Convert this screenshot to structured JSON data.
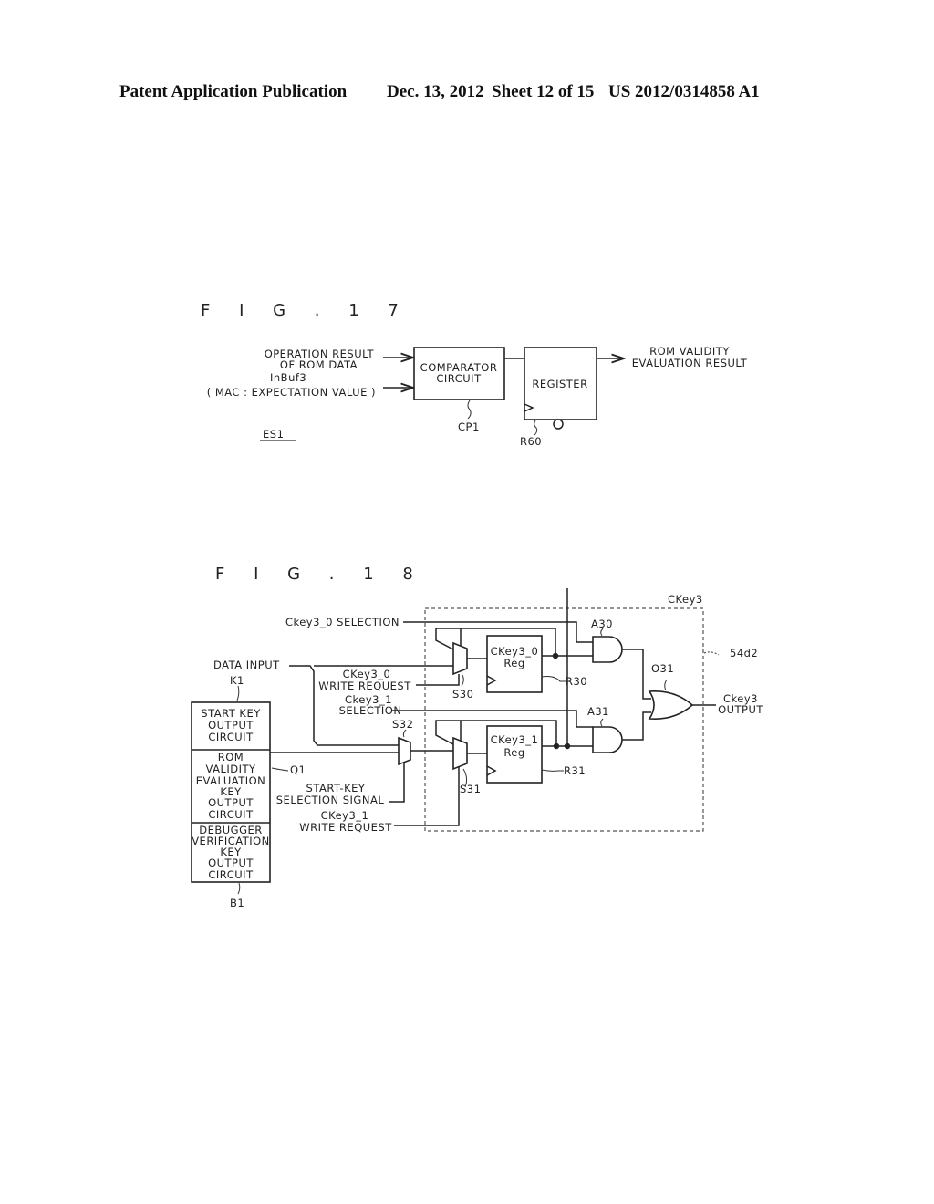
{
  "header": {
    "publication": "Patent Application Publication",
    "date": "Dec. 13, 2012",
    "sheet": "Sheet 12 of 15",
    "number": "US 2012/0314858 A1"
  },
  "fig17": {
    "title": "F I G . 1 7",
    "input1_line1": "OPERATION RESULT",
    "input1_line2": "OF ROM DATA",
    "input2_line1": "InBuf3",
    "input2_line2": "( MAC : EXPECTATION VALUE )",
    "comparator_line1": "COMPARATOR",
    "comparator_line2": "CIRCUIT",
    "comparator_ref": "CP1",
    "register_label": "REGISTER",
    "register_ref": "R60",
    "output_line1": "ROM VALIDITY",
    "output_line2": "EVALUATION RESULT",
    "system_ref": "ES1"
  },
  "fig18": {
    "title": "F I G . 1 8",
    "block_ref": "CKey3",
    "block_id": "54d2",
    "sel0_label": "Ckey3_0 SELECTION",
    "data_input": "DATA INPUT",
    "k1_ref": "K1",
    "wr0_line1": "CKey3_0",
    "wr0_line2": "WRITE REQUEST",
    "sel1_line1": "Ckey3_1",
    "sel1_line2": "SELECTION",
    "s32_ref": "S32",
    "s30_ref": "S30",
    "s31_ref": "S31",
    "reg0_line1": "CKey3_0",
    "reg0_line2": "Reg",
    "reg1_line1": "CKey3_1",
    "reg1_line2": "Reg",
    "r30_ref": "R30",
    "r31_ref": "R31",
    "a30_ref": "A30",
    "a31_ref": "A31",
    "o31_ref": "O31",
    "out_line1": "Ckey3",
    "out_line2": "OUTPUT",
    "q1_ref": "Q1",
    "startkey_sel_line1": "START-KEY",
    "startkey_sel_line2": "SELECTION SIGNAL",
    "wr1_line1": "CKey3_1",
    "wr1_line2": "WRITE REQUEST",
    "b1_ref": "B1",
    "key_blocks": [
      [
        "START KEY",
        "OUTPUT",
        "CIRCUIT"
      ],
      [
        "ROM",
        "VALIDITY",
        "EVALUATION",
        "KEY",
        "OUTPUT",
        "CIRCUIT"
      ],
      [
        "DEBUGGER",
        "VERIFICATION",
        "KEY",
        "OUTPUT",
        "CIRCUIT"
      ]
    ]
  }
}
